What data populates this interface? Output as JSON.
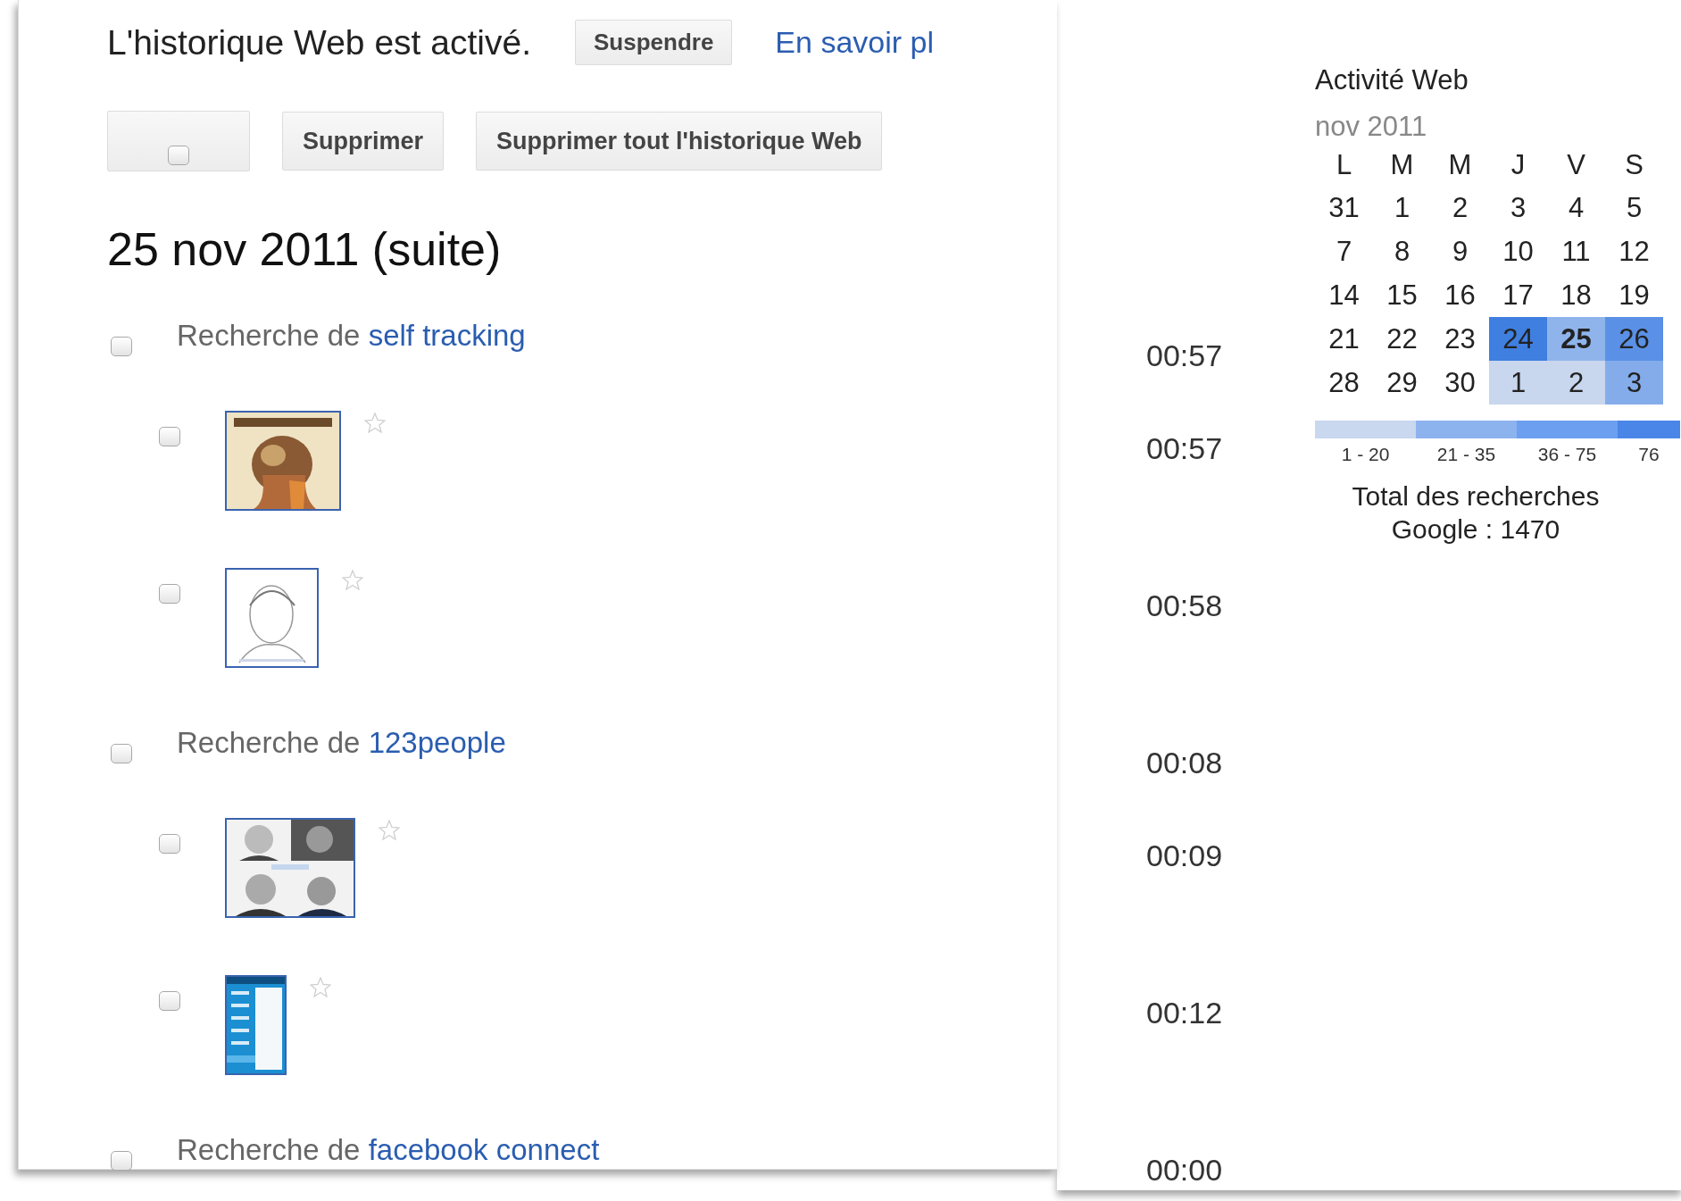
{
  "status": {
    "text": "L'historique Web est activé.",
    "button": "Suspendre",
    "link": "En savoir pl"
  },
  "toolbar": {
    "select_all_checked": false,
    "buttons": [
      "Supprimer",
      "Supprimer tout l'historique Web"
    ]
  },
  "heading": "25 nov 2011 (suite)",
  "entries": [
    {
      "kind": "search",
      "prefix": "Recherche de ",
      "query": "self tracking",
      "time": "00:57",
      "checked": false
    },
    {
      "kind": "picture",
      "time": "00:57",
      "checked": false,
      "starred": false
    },
    {
      "kind": "picture",
      "time": "00:58",
      "checked": false,
      "starred": false
    },
    {
      "kind": "search",
      "prefix": "Recherche de ",
      "query": "123people",
      "time": "00:08",
      "checked": false
    },
    {
      "kind": "picture",
      "time": "00:09",
      "checked": false,
      "starred": false
    },
    {
      "kind": "picture",
      "time": "00:12",
      "checked": false,
      "starred": false
    },
    {
      "kind": "search",
      "prefix": "Recherche de ",
      "query": "facebook connect",
      "time": "00:00",
      "checked": false
    }
  ],
  "calendar": {
    "title": "Activité Web",
    "month": "nov 2011",
    "weekdays": [
      "L",
      "M",
      "M",
      "J",
      "V",
      "S"
    ],
    "weeks": [
      [
        {
          "day": "31",
          "selected": false
        },
        {
          "day": "1",
          "selected": false
        },
        {
          "day": "2",
          "selected": false
        },
        {
          "day": "3",
          "selected": false
        },
        {
          "day": "4",
          "selected": false
        },
        {
          "day": "5",
          "selected": false
        }
      ],
      [
        {
          "day": "7",
          "selected": false
        },
        {
          "day": "8",
          "selected": false
        },
        {
          "day": "9",
          "selected": false
        },
        {
          "day": "10",
          "selected": false
        },
        {
          "day": "11",
          "selected": false
        },
        {
          "day": "12",
          "selected": false
        }
      ],
      [
        {
          "day": "14",
          "selected": false
        },
        {
          "day": "15",
          "selected": false
        },
        {
          "day": "16",
          "selected": false
        },
        {
          "day": "17",
          "selected": false
        },
        {
          "day": "18",
          "selected": false
        },
        {
          "day": "19",
          "selected": false
        }
      ],
      [
        {
          "day": "21",
          "selected": false
        },
        {
          "day": "22",
          "selected": false
        },
        {
          "day": "23",
          "selected": false
        },
        {
          "day": "24",
          "selected": false,
          "color": "#3f7fe0"
        },
        {
          "day": "25",
          "selected": true,
          "color": "#8fb4ec"
        },
        {
          "day": "26",
          "selected": false,
          "color": "#5a90e6"
        }
      ],
      [
        {
          "day": "28",
          "selected": false
        },
        {
          "day": "29",
          "selected": false
        },
        {
          "day": "30",
          "selected": false
        },
        {
          "day": "1",
          "selected": false,
          "color": "#c8d6ee"
        },
        {
          "day": "2",
          "selected": false,
          "color": "#c8d6ee"
        },
        {
          "day": "3",
          "selected": false,
          "color": "#84acea"
        }
      ]
    ],
    "legend": [
      {
        "label": "1 - 20",
        "color": "#c9d7ef"
      },
      {
        "label": "21 - 35",
        "color": "#8db3ef"
      },
      {
        "label": "36 - 75",
        "color": "#6c9ff0"
      },
      {
        "label": "76",
        "color": "#4a86e8"
      }
    ],
    "total": "Total des recherches\nGoogle : 1470"
  }
}
